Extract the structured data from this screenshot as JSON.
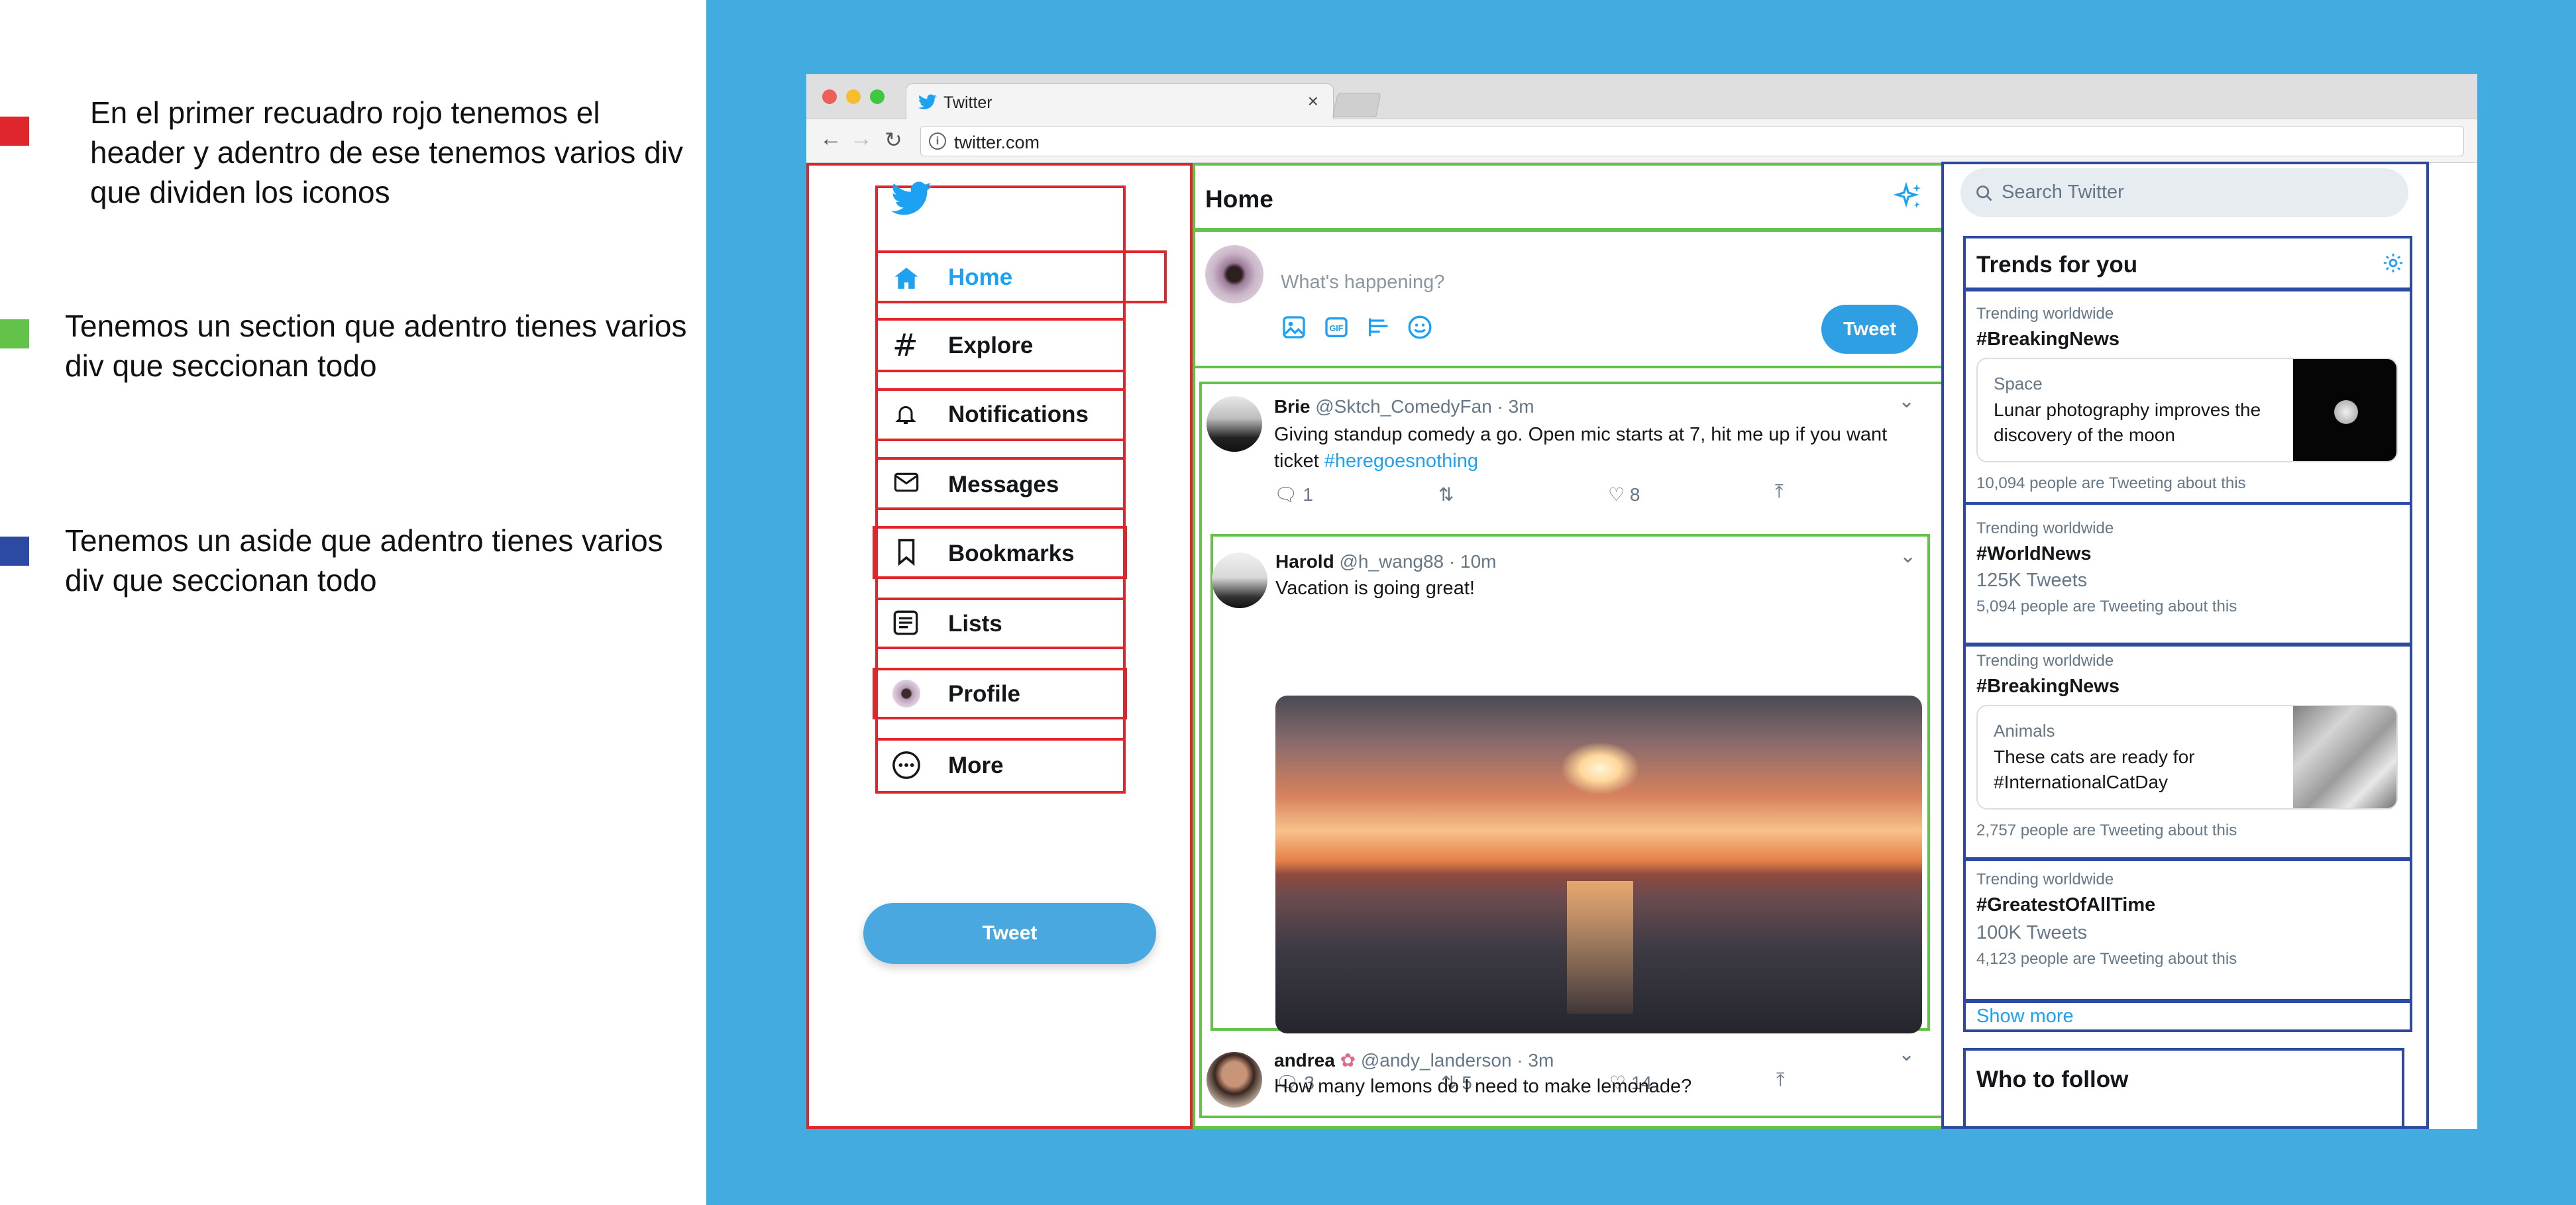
{
  "legend": [
    {
      "color": "#e0262d",
      "lines": [
        "En el primer recuadro rojo tenemos el",
        "header y adentro de ese tenemos varios div",
        "que dividen los iconos"
      ]
    },
    {
      "color": "#62c24a",
      "lines": [
        "Tenemos un section que adentro tienes varios",
        "div que seccionan todo"
      ]
    },
    {
      "color": "#2c4aa2",
      "lines": [
        "Tenemos un aside que adentro tienes varios",
        "div que seccionan todo"
      ]
    }
  ],
  "browser": {
    "tab_title": "Twitter",
    "tab_close": "×",
    "url": "twitter.com"
  },
  "nav": {
    "items": [
      {
        "label": "Home",
        "icon": "home-icon",
        "active": true
      },
      {
        "label": "Explore",
        "icon": "hashtag-icon"
      },
      {
        "label": "Notifications",
        "icon": "bell-icon"
      },
      {
        "label": "Messages",
        "icon": "envelope-icon"
      },
      {
        "label": "Bookmarks",
        "icon": "bookmark-icon"
      },
      {
        "label": "Lists",
        "icon": "list-icon"
      },
      {
        "label": "Profile",
        "icon": "avatar-icon"
      },
      {
        "label": "More",
        "icon": "more-icon"
      }
    ],
    "tweet_button": "Tweet"
  },
  "main": {
    "title": "Home",
    "compose_placeholder": "What's happening?",
    "compose_button": "Tweet",
    "tweets": [
      {
        "name": "Brie",
        "handle": "@Sktch_ComedyFan · 3m",
        "text_line1": "Giving standup comedy a go. Open mic starts at 7, hit me up if you want",
        "text_line2": "ticket ",
        "hashtag": "#heregoesnothing",
        "replies": "1",
        "retweets": "",
        "likes": "8"
      },
      {
        "name": "Harold",
        "handle": "@h_wang88 · 10m",
        "text": "Vacation is going great!",
        "replies": "3",
        "retweets": "5",
        "likes": "14"
      },
      {
        "name": "andrea",
        "handle": "@andy_landerson · 3m",
        "text": "How many lemons do I need to make lemonade?"
      }
    ]
  },
  "aside": {
    "search_placeholder": "Search Twitter",
    "trends_title": "Trends for you",
    "trends": [
      {
        "context": "Trending worldwide",
        "tag": "#BreakingNews",
        "card_category": "Space",
        "card_text": [
          "Lunar photography improves the",
          "discovery of the moon"
        ],
        "people": "10,094 people are Tweeting about this"
      },
      {
        "context": "Trending worldwide",
        "tag": "#WorldNews",
        "count": "125K Tweets",
        "people": "5,094 people are Tweeting about this"
      },
      {
        "context": "Trending worldwide",
        "tag": "#BreakingNews",
        "card_category": "Animals",
        "card_text": [
          "These cats are ready for",
          "#InternationalCatDay"
        ],
        "people": "2,757 people are Tweeting about this"
      },
      {
        "context": "Trending worldwide",
        "tag": "#GreatestOfAllTime",
        "count": "100K Tweets",
        "people": "4,123 people are Tweeting about this"
      }
    ],
    "show_more": "Show more",
    "who_to_follow": "Who to follow"
  },
  "colors": {
    "blue_bg": "#42ace0",
    "twitter_blue": "#1da1f2",
    "red_box": "#e0262d",
    "green_box": "#62c24a",
    "blue_box": "#2c4aa2"
  }
}
